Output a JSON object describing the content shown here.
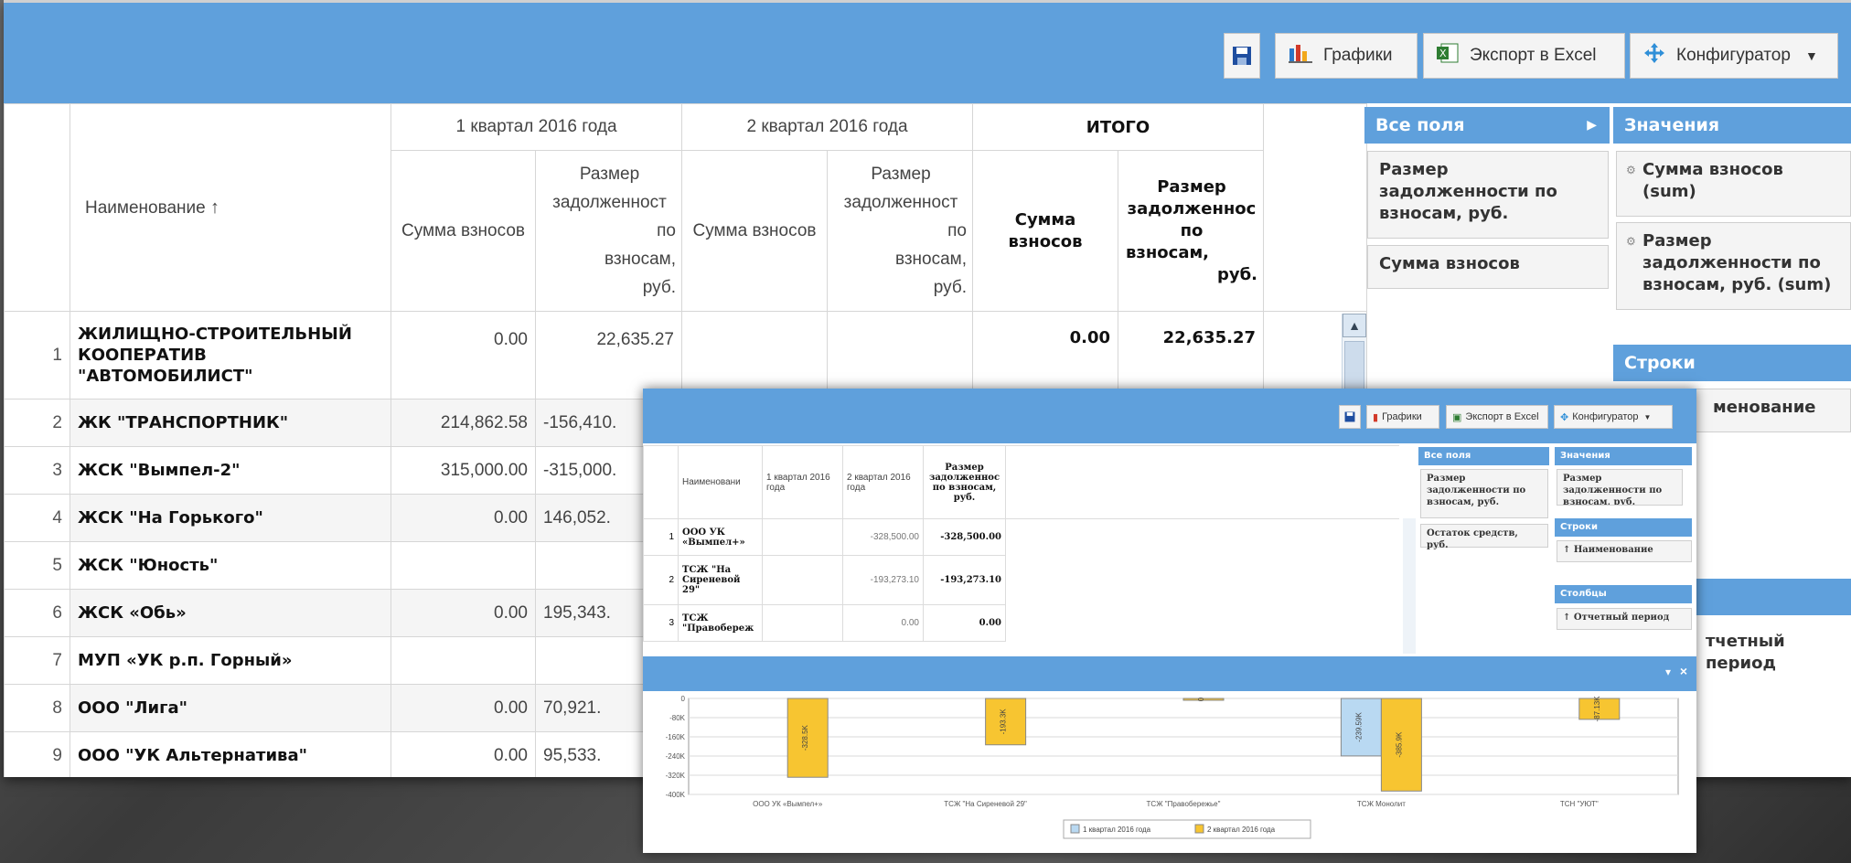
{
  "toolbar": {
    "save_icon": "floppy-disk-icon",
    "charts_label": "Графики",
    "excel_label": "Экспорт в Excel",
    "config_label": "Конфигуратор"
  },
  "table": {
    "name_header": "Наименование",
    "sort_icon": "↑",
    "q1_header": "1 квартал 2016 года",
    "q2_header": "2 квартал 2016 года",
    "total_header": "ИТОГО",
    "sum_header": "Сумма взносов",
    "debt_header_lines": [
      "Размер",
      "задолженност",
      "по",
      "взносам,",
      "руб."
    ],
    "debt_header_bold_lines": [
      "Размер",
      "задолженнос",
      "по",
      "взносам,",
      "руб."
    ],
    "rows": [
      {
        "n": "1",
        "name": "ЖИЛИЩНО-СТРОИТЕЛЬНЫЙ КООПЕРАТИВ \"АВТОМОБИЛИСТ\"",
        "q1_sum": "0.00",
        "q1_debt": "22,635.27",
        "q2_sum": "",
        "q2_debt": "",
        "t_sum": "0.00",
        "t_debt": "22,635.27"
      },
      {
        "n": "2",
        "name": "ЖК \"ТРАНСПОРТНИК\"",
        "q1_sum": "214,862.58",
        "q1_debt": "-156,410."
      },
      {
        "n": "3",
        "name": "ЖСК \"Вымпел-2\"",
        "q1_sum": "315,000.00",
        "q1_debt": "-315,000."
      },
      {
        "n": "4",
        "name": "ЖСК \"На Горького\"",
        "q1_sum": "0.00",
        "q1_debt": "146,052."
      },
      {
        "n": "5",
        "name": "ЖСК \"Юность\"",
        "q1_sum": "",
        "q1_debt": ""
      },
      {
        "n": "6",
        "name": "ЖСК «Обь»",
        "q1_sum": "0.00",
        "q1_debt": "195,343."
      },
      {
        "n": "7",
        "name": "МУП «УК р.п. Горный»",
        "q1_sum": "",
        "q1_debt": ""
      },
      {
        "n": "8",
        "name": "ООО \"Лига\"",
        "q1_sum": "0.00",
        "q1_debt": "70,921."
      },
      {
        "n": "9",
        "name": "ООО \"УК Альтернатива\"",
        "q1_sum": "0.00",
        "q1_debt": "95,533."
      }
    ]
  },
  "sidebar": {
    "all_fields_title": "Все поля",
    "all_fields_items": [
      "Размер задолженности по взносам, руб.",
      "Сумма взносов"
    ],
    "values_title": "Значения",
    "values_items": [
      "Сумма взносов (sum)",
      "Размер задолженности по взносам, руб. (sum)"
    ],
    "rows_title": "Строки",
    "rows_item": "менование",
    "cols_item_partial": "тчетный период"
  },
  "overlay": {
    "table": {
      "name_header": "Наименовани",
      "q1_header": "1 квартал 2016 года",
      "q2_header": "2 квартал 2016 года",
      "debt_header": "Размер задолженнос по взносам, руб.",
      "rows": [
        {
          "n": "1",
          "name": "ООО УК «Вымпел+»",
          "q2": "-328,500.00",
          "total": "-328,500.00"
        },
        {
          "n": "2",
          "name": "ТСЖ \"На Сиреневой 29\"",
          "q2": "-193,273.10",
          "total": "-193,273.10"
        },
        {
          "n": "3",
          "name": "ТСЖ \"Правобереж",
          "q2": "0.00",
          "total": "0.00"
        }
      ]
    },
    "sidebar": {
      "all_fields_title": "Все поля",
      "all_fields_items": [
        "Размер задолженности по взносам, руб.",
        "Остаток средств, руб."
      ],
      "values_title": "Значения",
      "values_item": "Размер задолженности по взносам, руб.",
      "rows_title": "Строки",
      "rows_item": "↑ Наименование",
      "cols_title": "Столбцы",
      "cols_item": "↑ Отчетный период"
    }
  },
  "chart_data": {
    "type": "bar",
    "categories": [
      "ООО УК «Вымпел+»",
      "ТСЖ \"На Сиреневой 29\"",
      "ТСЖ \"Правобережье\"",
      "ТСЖ Монолит",
      "ТСН \"УЮТ\""
    ],
    "series": [
      {
        "name": "1 квартал 2016 года",
        "color": "#b9d9f2",
        "values": [
          null,
          null,
          null,
          -239590,
          null
        ]
      },
      {
        "name": "2 квартал 2016 года",
        "color": "#f7c531",
        "values": [
          -328500,
          -193270,
          0,
          -385900,
          -87130
        ]
      }
    ],
    "value_labels": {
      "1 квартал 2016 года": [
        null,
        null,
        null,
        "-239.59K",
        null
      ],
      "2 квартал 2016 года": [
        "-328.5K",
        "-193.3K",
        "0",
        "-385.9K",
        "-87.13K"
      ]
    },
    "y_ticks": [
      "0",
      "-80K",
      "-160K",
      "-240K",
      "-320K",
      "-400K"
    ],
    "ylim": [
      -400000,
      0
    ],
    "legend_position": "bottom",
    "grid": true
  }
}
